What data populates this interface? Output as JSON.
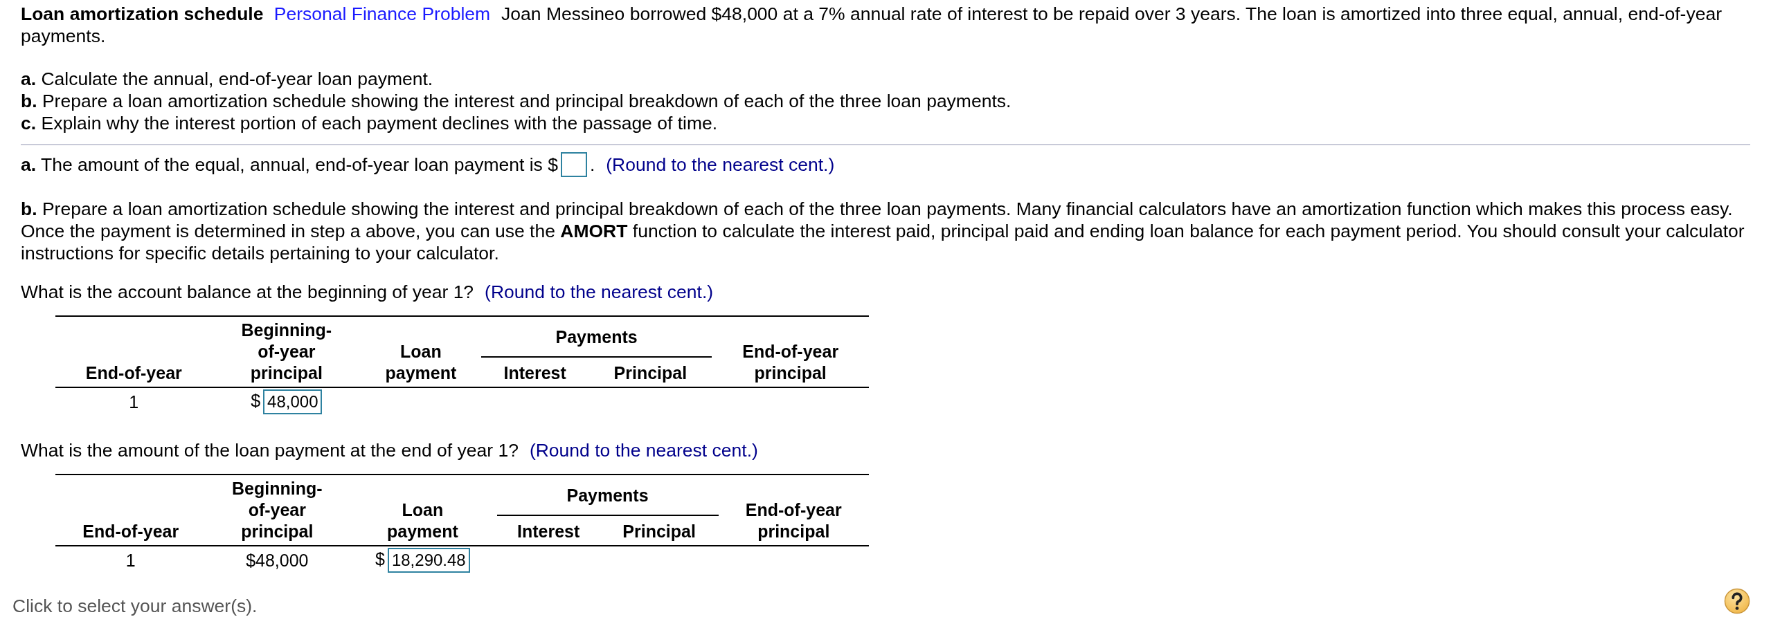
{
  "header": {
    "title": "Loan amortization schedule",
    "category": "Personal Finance Problem",
    "statement": [
      "Joan Messineo borrowed $48,000 at a 7% annual rate of interest to be repaid over 3 years.  The loan is amortized into three equal, annual, end-of-year",
      "payments."
    ]
  },
  "tasks": [
    {
      "label": "a.",
      "text": "Calculate the annual, end-of-year loan payment."
    },
    {
      "label": "b.",
      "text": "Prepare a loan amortization schedule showing the interest and principal breakdown of each of the three loan payments."
    },
    {
      "label": "c.",
      "text": "Explain why the interest portion of each payment declines with the passage of time."
    }
  ],
  "part_a": {
    "label": "a.",
    "text": "The amount of the equal, annual, end-of-year loan payment is",
    "currency": "$",
    "after": ".",
    "hint": "(Round to the nearest cent.)"
  },
  "part_b": {
    "label": "b.",
    "text": "Prepare a loan amortization schedule showing the interest and principal breakdown of each of the three loan payments.  Many financial calculators have an amortization function which makes this process easy.  Once the payment is determined in step a above, you can use the **AMORT** function to calculate the interest paid, principal paid and ending loan balance for each payment period.  You should consult your calculator instructions for specific details pertaining to your calculator."
  },
  "questions": [
    {
      "text": "What is the account balance at the beginning of year 1?",
      "hint": "(Round to the nearest cent.)",
      "table": {
        "group": "Payments",
        "columns": [
          {
            "lines": [
              "End-of-year"
            ]
          },
          {
            "lines": [
              "Beginning-",
              "of-year",
              "principal"
            ]
          },
          {
            "lines": [
              "Loan",
              "payment"
            ]
          },
          {
            "lines": [
              "Interest"
            ]
          },
          {
            "lines": [
              "Principal"
            ]
          },
          {
            "lines": [
              "End-of-year",
              "principal"
            ]
          }
        ],
        "rows": [
          {
            "cells": [
              {
                "kind": "text",
                "text": "1"
              },
              {
                "kind": "field",
                "prefix": "$",
                "value": "48,000"
              }
            ]
          }
        ]
      }
    },
    {
      "text": "What is the amount of the loan payment at the end of year 1?",
      "hint": "(Round to the nearest cent.)",
      "table": {
        "group": "Payments",
        "columns": [
          {
            "lines": [
              "End-of-year"
            ]
          },
          {
            "lines": [
              "Beginning-",
              "of-year",
              "principal"
            ]
          },
          {
            "lines": [
              "Loan",
              "payment"
            ]
          },
          {
            "lines": [
              "Interest"
            ]
          },
          {
            "lines": [
              "Principal"
            ]
          },
          {
            "lines": [
              "End-of-year",
              "principal"
            ]
          }
        ],
        "rows": [
          {
            "cells": [
              {
                "kind": "text",
                "text": "1"
              },
              {
                "kind": "text",
                "text": "$48,000"
              },
              {
                "kind": "field",
                "prefix": "$",
                "value": "18,290.48"
              }
            ]
          }
        ]
      }
    }
  ],
  "footer": {
    "text": "Click to select your answer(s)."
  }
}
